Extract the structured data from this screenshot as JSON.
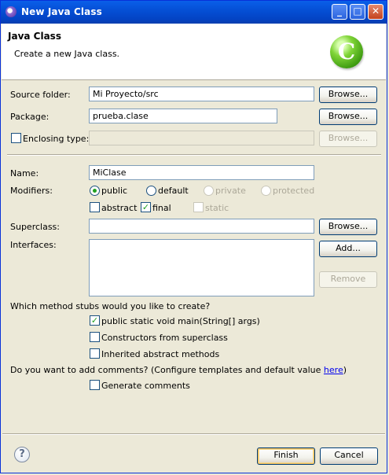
{
  "window": {
    "title": "New Java Class"
  },
  "header": {
    "title": "Java Class",
    "description": "Create a new Java class.",
    "logo_letter": "C"
  },
  "form": {
    "source_folder": {
      "label": "Source folder:",
      "value": "Mi Proyecto/src",
      "browse_label": "Browse..."
    },
    "package": {
      "label": "Package:",
      "value": "prueba.clase",
      "browse_label": "Browse..."
    },
    "enclosing_type": {
      "label": "Enclosing type:",
      "value": "",
      "browse_label": "Browse...",
      "checked": false
    },
    "name": {
      "label": "Name:",
      "value": "MiClase"
    },
    "modifiers": {
      "label": "Modifiers:",
      "access": [
        "public",
        "default",
        "private",
        "protected"
      ],
      "selected_access": "public",
      "other": [
        "abstract",
        "final",
        "static"
      ],
      "checked_other": [
        "final"
      ]
    },
    "superclass": {
      "label": "Superclass:",
      "value": "",
      "browse_label": "Browse..."
    },
    "interfaces": {
      "label": "Interfaces:",
      "add_label": "Add...",
      "remove_label": "Remove",
      "items": []
    },
    "stubs": {
      "question": "Which method stubs would you like to create?",
      "options": [
        {
          "label": "public static void main(String[] args)",
          "checked": true
        },
        {
          "label": "Constructors from superclass",
          "checked": false
        },
        {
          "label": "Inherited abstract methods",
          "checked": false
        }
      ]
    },
    "comments": {
      "question_prefix": "Do you want to add comments? (Configure templates and default value ",
      "link_text": "here",
      "question_suffix": ")",
      "option_label": "Generate comments",
      "checked": false
    }
  },
  "footer": {
    "help_symbol": "?",
    "finish_label": "Finish",
    "cancel_label": "Cancel"
  }
}
